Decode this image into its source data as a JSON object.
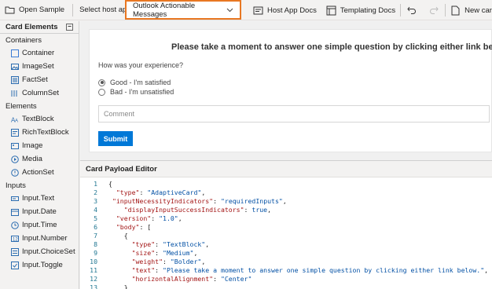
{
  "toolbar": {
    "open_sample": "Open Sample",
    "select_host_app": "Select host app",
    "host_app_value": "Outlook Actionable Messages",
    "host_app_docs": "Host App Docs",
    "templating_docs": "Templating Docs",
    "new_card": "New card"
  },
  "sidebar": {
    "title": "Card Elements",
    "groups": {
      "containers": "Containers",
      "elements": "Elements",
      "inputs": "Inputs"
    },
    "container_items": [
      "Container",
      "ImageSet",
      "FactSet",
      "ColumnSet"
    ],
    "element_items": [
      "TextBlock",
      "RichTextBlock",
      "Image",
      "Media",
      "ActionSet"
    ],
    "input_items": [
      "Input.Text",
      "Input.Date",
      "Input.Time",
      "Input.Number",
      "Input.ChoiceSet",
      "Input.Toggle"
    ]
  },
  "card": {
    "title": "Please take a moment to answer one simple question by clicking either link below.",
    "question": "How was your experience?",
    "options": [
      "Good - I'm satisfied",
      "Bad - I'm unsatisfied"
    ],
    "selected_option": "Good - I'm satisfied",
    "comment_placeholder": "Comment",
    "submit_label": "Submit"
  },
  "editor": {
    "title": "Card Payload Editor",
    "line_numbers": [
      "1",
      "2",
      "3",
      "4",
      "5",
      "6",
      "7",
      "8",
      "9",
      "10",
      "11",
      "12",
      "13"
    ],
    "lines": [
      "{",
      "  \"type\": \"AdaptiveCard\",",
      " \"inputNecessityIndicators\": \"requiredInputs\",",
      "    \"displayInputSuccessIndicators\": true,",
      "  \"version\": \"1.0\",",
      "  \"body\": [",
      "    {",
      "      \"type\": \"TextBlock\",",
      "      \"size\": \"Medium\",",
      "      \"weight\": \"Bolder\",",
      "      \"text\": \"Please take a moment to answer one simple question by clicking either link below.\",",
      "      \"horizontalAlignment\": \"Center\"",
      "    }"
    ]
  },
  "colors": {
    "accent": "#0078d7",
    "highlight_border": "#e87722",
    "json_key": "#a31515",
    "json_string": "#0451a5"
  }
}
